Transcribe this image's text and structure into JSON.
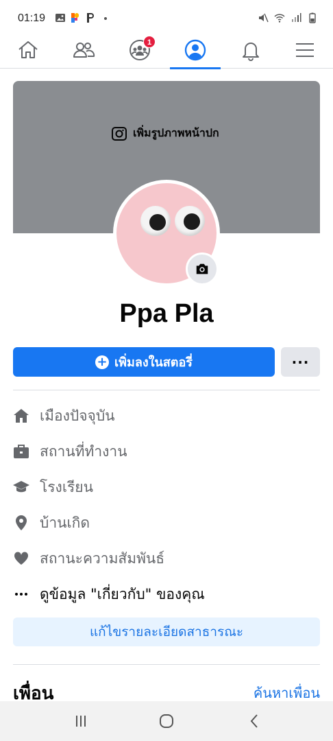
{
  "status_bar": {
    "time": "01:19",
    "left_icons": [
      "image-icon",
      "p-app-icon",
      "p-app-icon",
      "dot-icon"
    ],
    "right_icons": [
      "mute-icon",
      "wifi-icon",
      "signal-icon",
      "battery-icon"
    ]
  },
  "nav": {
    "items": [
      {
        "name": "home",
        "icon": "home-icon"
      },
      {
        "name": "friends",
        "icon": "friends-icon"
      },
      {
        "name": "groups",
        "icon": "groups-icon",
        "badge": "1"
      },
      {
        "name": "profile",
        "icon": "profile-icon",
        "active": true
      },
      {
        "name": "notifications",
        "icon": "bell-icon"
      },
      {
        "name": "menu",
        "icon": "menu-icon"
      }
    ]
  },
  "cover": {
    "add_cover_label": "เพิ่มรูปภาพหน้าปก"
  },
  "profile": {
    "name": "Ppa Pla"
  },
  "actions": {
    "add_story_label": "เพิ่มลงในสตอรี่",
    "more_label": "···"
  },
  "info": {
    "items": [
      {
        "icon": "home-icon",
        "label": "เมืองปัจจุบัน"
      },
      {
        "icon": "briefcase-icon",
        "label": "สถานที่ทำงาน"
      },
      {
        "icon": "graduation-cap-icon",
        "label": "โรงเรียน"
      },
      {
        "icon": "location-pin-icon",
        "label": "บ้านเกิด"
      },
      {
        "icon": "heart-icon",
        "label": "สถานะความสัมพันธ์"
      },
      {
        "icon": "more-dots-icon",
        "label": "ดูข้อมูล \"เกี่ยวกับ\" ของคุณ"
      }
    ],
    "edit_public_details_label": "แก้ไขรายละเอียดสาธารณะ"
  },
  "friends": {
    "title": "เพื่อน",
    "find_friends_label": "ค้นหาเพื่อน"
  },
  "colors": {
    "accent": "#1877f2",
    "cover": "#8a8d91",
    "badge": "#e41e3f",
    "secondary_text": "#65676b"
  }
}
